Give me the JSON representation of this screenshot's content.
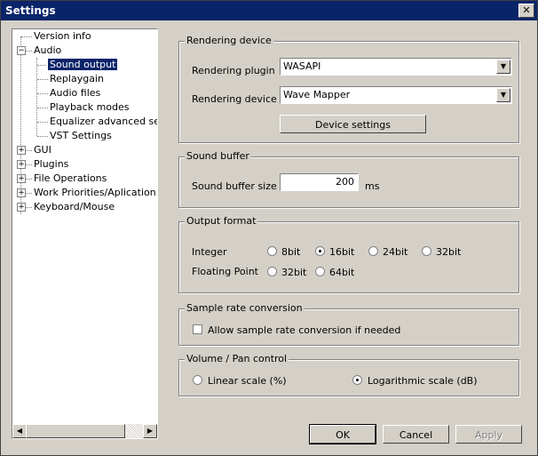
{
  "window": {
    "title": "Settings",
    "close_glyph": "✕"
  },
  "tree": {
    "items": [
      {
        "label": "Version info",
        "level": 0,
        "expander": ""
      },
      {
        "label": "Audio",
        "level": 0,
        "expander": "−"
      },
      {
        "label": "Sound output",
        "level": 1,
        "expander": "",
        "selected": true
      },
      {
        "label": "Replaygain",
        "level": 1,
        "expander": ""
      },
      {
        "label": "Audio files",
        "level": 1,
        "expander": ""
      },
      {
        "label": "Playback modes",
        "level": 1,
        "expander": ""
      },
      {
        "label": "Equalizer advanced setti",
        "level": 1,
        "expander": ""
      },
      {
        "label": "VST Settings",
        "level": 1,
        "expander": ""
      },
      {
        "label": "GUI",
        "level": 0,
        "expander": "+"
      },
      {
        "label": "Plugins",
        "level": 0,
        "expander": "+"
      },
      {
        "label": "File Operations",
        "level": 0,
        "expander": "+"
      },
      {
        "label": "Work Priorities/Aplication set",
        "level": 0,
        "expander": "+"
      },
      {
        "label": "Keyboard/Mouse",
        "level": 0,
        "expander": "+"
      }
    ],
    "scroll_left_glyph": "◀",
    "scroll_right_glyph": "▶"
  },
  "rendering_device": {
    "title": "Rendering device",
    "plugin_label": "Rendering plugin",
    "plugin_value": "WASAPI",
    "device_label": "Rendering device",
    "device_value": "Wave Mapper",
    "settings_button": "Device settings",
    "dropdown_glyph": "▼"
  },
  "sound_buffer": {
    "title": "Sound buffer",
    "size_label": "Sound buffer size",
    "size_value": "200",
    "unit": "ms"
  },
  "output_format": {
    "title": "Output format",
    "integer_label": "Integer",
    "integer_options": [
      {
        "label": "8bit",
        "checked": false
      },
      {
        "label": "16bit",
        "checked": true
      },
      {
        "label": "24bit",
        "checked": false
      },
      {
        "label": "32bit",
        "checked": false
      }
    ],
    "float_label": "Floating Point",
    "float_options": [
      {
        "label": "32bit",
        "checked": false
      },
      {
        "label": "64bit",
        "checked": false
      }
    ]
  },
  "sample_rate": {
    "title": "Sample rate conversion",
    "allow_label": "Allow sample rate conversion if needed",
    "allow_checked": false
  },
  "volume": {
    "title": "Volume / Pan control",
    "linear_label": "Linear scale (%)",
    "linear_checked": false,
    "log_label": "Logarithmic scale (dB)",
    "log_checked": true
  },
  "buttons": {
    "ok": "OK",
    "cancel": "Cancel",
    "apply": "Apply"
  }
}
